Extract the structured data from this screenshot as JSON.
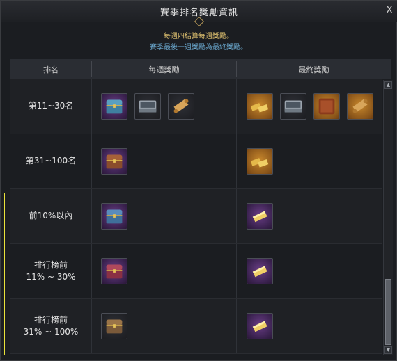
{
  "dialog": {
    "title": "賽季排名獎勵資訊",
    "close_label": "X",
    "notice_line1": "每週四結算每週獎勵。",
    "notice_line2": "賽季最後一週獎勵為最終獎勵。"
  },
  "columns": [
    "排名",
    "每週獎勵",
    "最終獎勵"
  ],
  "rows": [
    {
      "rank_line1": "第11~30名",
      "rank_line2": "",
      "weekly": [
        {
          "icon": "treasure-chest-icon",
          "frame": "purple"
        },
        {
          "icon": "steel-case-icon",
          "frame": "gray"
        },
        {
          "icon": "scroll-icon",
          "frame": "gray"
        }
      ],
      "final": [
        {
          "icon": "gold-bars-icon",
          "frame": "orange"
        },
        {
          "icon": "steel-case-icon",
          "frame": "gray"
        },
        {
          "icon": "leather-pouch-icon",
          "frame": "orange"
        },
        {
          "icon": "scroll-icon",
          "frame": "orange"
        }
      ]
    },
    {
      "rank_line1": "第31~100名",
      "rank_line2": "",
      "weekly": [
        {
          "icon": "wooden-chest-icon",
          "frame": "purple"
        }
      ],
      "final": [
        {
          "icon": "gold-bars-icon",
          "frame": "orange"
        }
      ]
    },
    {
      "rank_line1": "前10%以內",
      "rank_line2": "",
      "weekly": [
        {
          "icon": "blue-chest-icon",
          "frame": "purple"
        }
      ],
      "final": [
        {
          "icon": "gold-bar-icon",
          "frame": "purple"
        }
      ]
    },
    {
      "rank_line1": "排行榜前",
      "rank_line2": "11% ~ 30%",
      "weekly": [
        {
          "icon": "red-chest-icon",
          "frame": "purple"
        }
      ],
      "final": [
        {
          "icon": "gold-bar-icon",
          "frame": "purple"
        }
      ]
    },
    {
      "rank_line1": "排行榜前",
      "rank_line2": "31% ~ 100%",
      "weekly": [
        {
          "icon": "brown-chest-icon",
          "frame": "gray"
        }
      ],
      "final": [
        {
          "icon": "gold-bar-icon",
          "frame": "purple"
        }
      ]
    }
  ],
  "colors": {
    "highlight_border": "#e9e13a",
    "notice_gold": "#e0c270",
    "notice_blue": "#6fb0d8"
  },
  "scrollbar": {
    "up": "▲",
    "down": "▼"
  }
}
